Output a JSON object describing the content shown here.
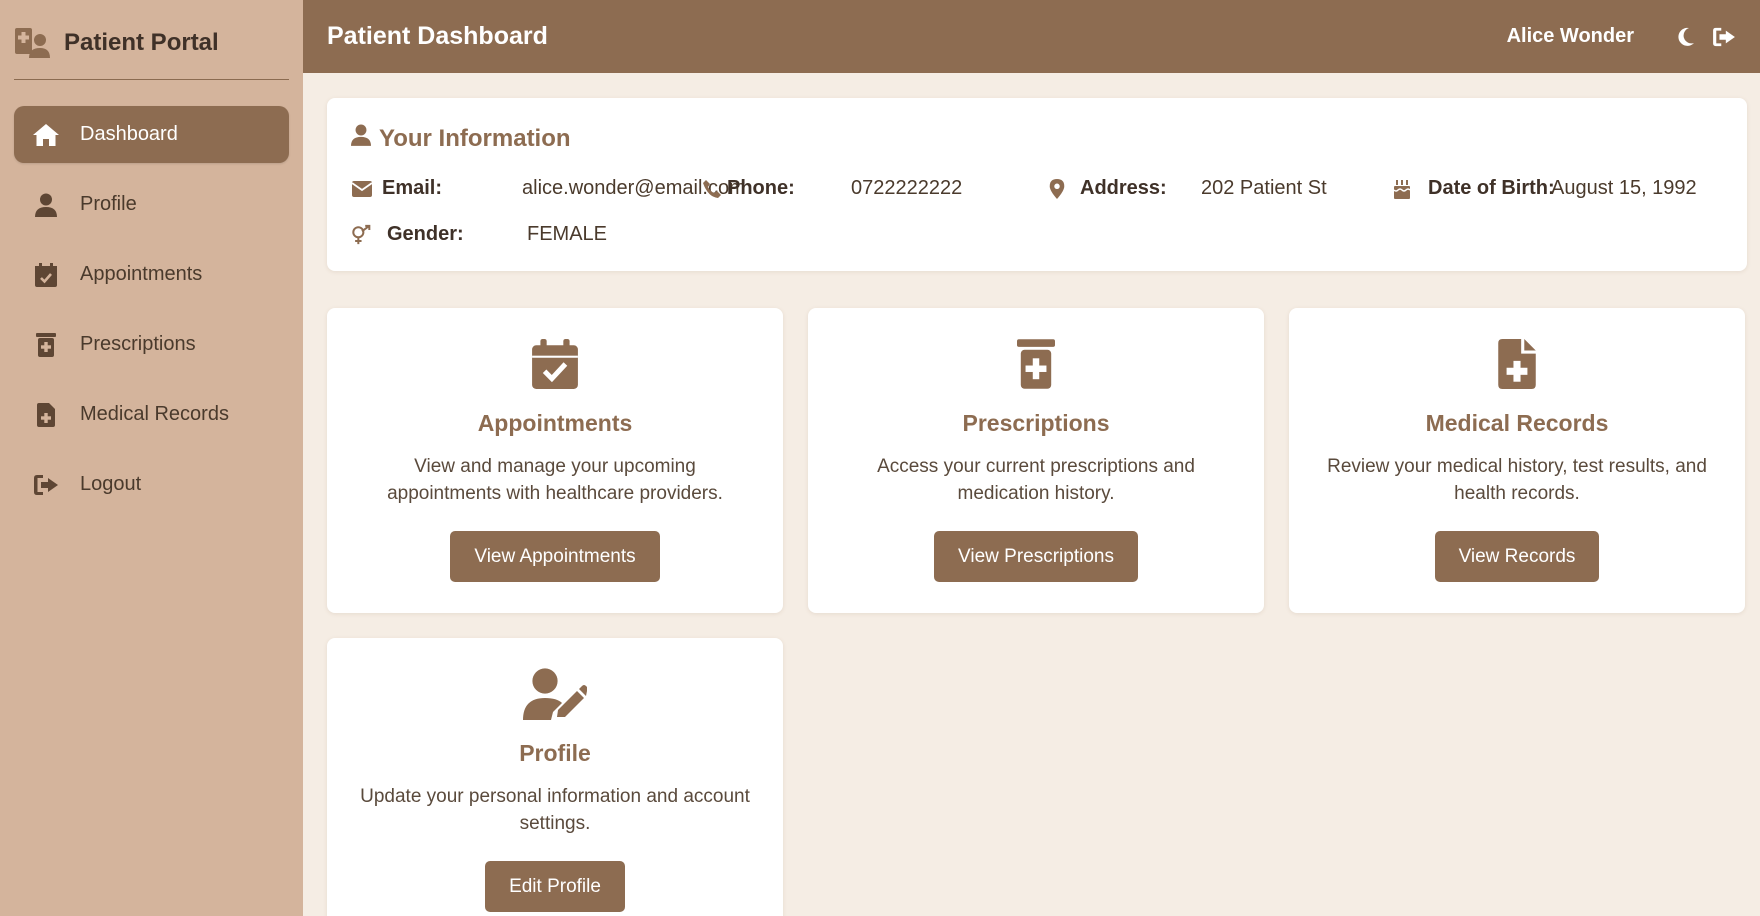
{
  "sidebar": {
    "brand_title": "Patient Portal",
    "items": [
      {
        "label": "Dashboard",
        "icon": "home-icon",
        "active": true
      },
      {
        "label": "Profile",
        "icon": "user-icon"
      },
      {
        "label": "Appointments",
        "icon": "calendar-check-icon"
      },
      {
        "label": "Prescriptions",
        "icon": "prescription-bottle-icon"
      },
      {
        "label": "Medical Records",
        "icon": "file-medical-icon"
      },
      {
        "label": "Logout",
        "icon": "sign-out-icon"
      }
    ]
  },
  "header": {
    "title": "Patient Dashboard",
    "user_name": "Alice Wonder"
  },
  "info": {
    "title": "Your Information",
    "email_label": "Email:",
    "email_value": "alice.wonder@email.com",
    "phone_label": "Phone:",
    "phone_value": "0722222222",
    "address_label": "Address:",
    "address_value": "202 Patient St",
    "dob_label": "Date of Birth:",
    "dob_value": "August 15, 1992",
    "gender_label": "Gender:",
    "gender_value": "FEMALE"
  },
  "cards": [
    {
      "title": "Appointments",
      "desc": "View and manage your upcoming appointments with healthcare providers.",
      "button": "View Appointments",
      "icon": "calendar-check-icon"
    },
    {
      "title": "Prescriptions",
      "desc": "Access your current prescriptions and medication history.",
      "button": "View Prescriptions",
      "icon": "prescription-bottle-icon"
    },
    {
      "title": "Medical Records",
      "desc": "Review your medical history, test results, and health records.",
      "button": "View Records",
      "icon": "file-medical-icon"
    },
    {
      "title": "Profile",
      "desc": "Update your personal information and account settings.",
      "button": "Edit Profile",
      "icon": "user-edit-icon"
    }
  ],
  "colors": {
    "primary": "#8d6c51",
    "sidebar_bg": "#d4b49c",
    "page_bg": "#f5ede4"
  }
}
